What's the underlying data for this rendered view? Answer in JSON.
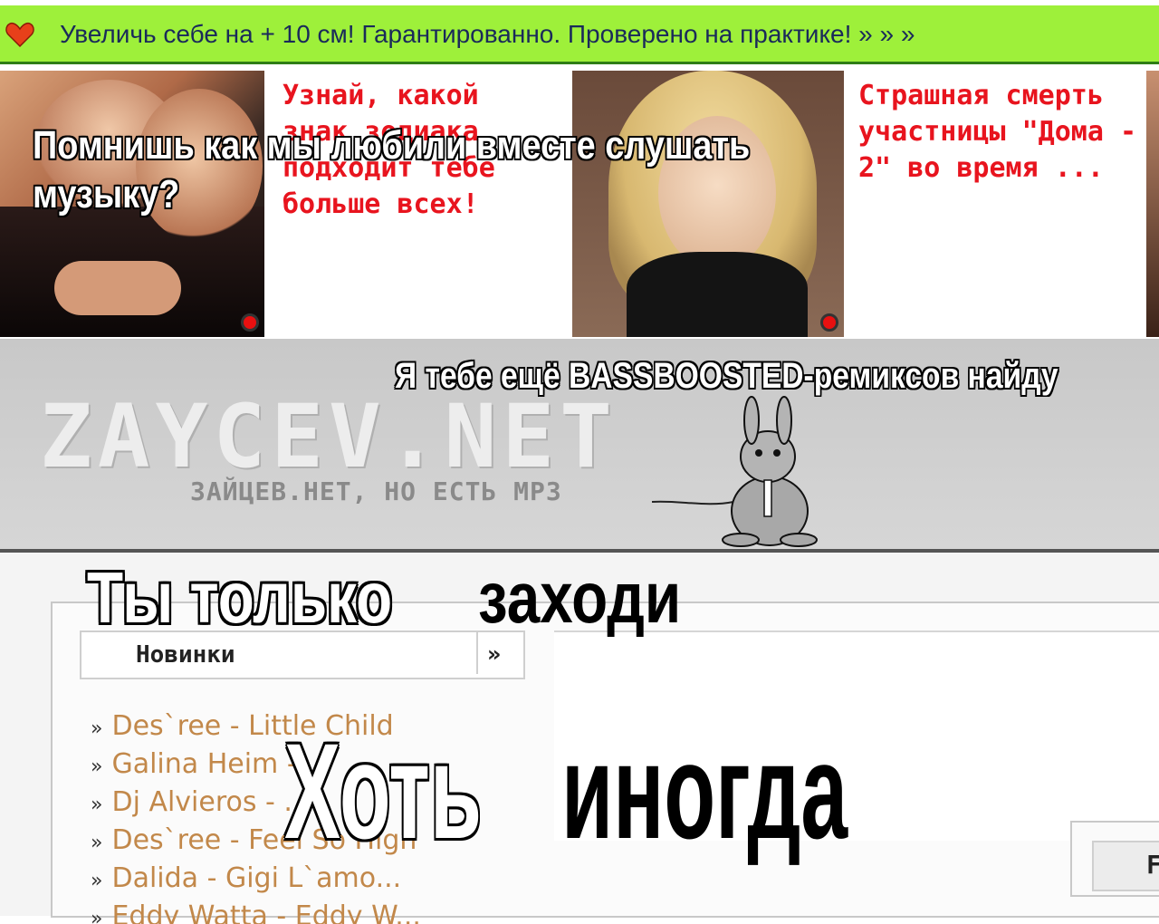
{
  "top_ad": {
    "text": "Увеличь себе на + 10 см! Гарантированно. Проверено на практике! » » »",
    "icon": "heart-icon",
    "bg_color": "#9ef03a"
  },
  "ads": [
    {
      "text": "Узнай, какой знак зодиака подходит тебе больше всех!"
    },
    {
      "text": "Страшная смерть участницы \"Дома - 2\" во время ..."
    }
  ],
  "band": {
    "logo": "ZAYCEV.NET",
    "subtitle": "ЗАЙЦЕВ.НЕТ, НО ЕСТЬ MP3"
  },
  "panel": {
    "title": "Новинки",
    "more": "»",
    "items": [
      "Des`ree - Little Child",
      "Galina Heim - ...",
      "Dj Alvieros - ...",
      "Des`ree - Feel So High",
      "Dalida - Gigi L`amo...",
      "Eddy Watta - Eddy W..."
    ],
    "bullet": "»",
    "button_label": "F"
  },
  "captions": {
    "line1": "Помнишь как мы любили вместе слушать музыку?",
    "line2": "Я тебе ещё BASSBOOSTED-ремиксов найду",
    "line3_white": "Ты только",
    "line3_black": "заходи",
    "line4_white": "Хоть",
    "line4_black": "иногда"
  }
}
